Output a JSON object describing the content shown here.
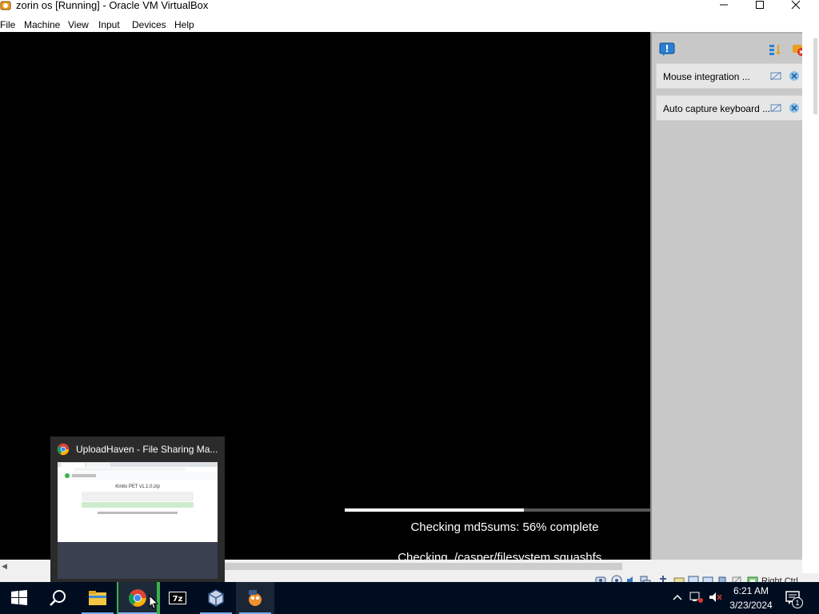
{
  "window": {
    "title": "zorin os [Running] - Oracle VM VirtualBox",
    "controls": [
      "minimize",
      "maximize",
      "close"
    ]
  },
  "menu": {
    "items": [
      "File",
      "Machine",
      "View",
      "Input",
      "Devices",
      "Help"
    ]
  },
  "vm": {
    "progress_percent": 56,
    "progress_text": "Checking md5sums: 56% complete",
    "checking_text": "Checking ./casper/filesystem.squashfs..."
  },
  "notifications": {
    "items": [
      {
        "label": "Mouse integration ..."
      },
      {
        "label": "Auto capture keyboard ..."
      }
    ]
  },
  "statusbar": {
    "host_key": "Right Ctrl"
  },
  "preview": {
    "title": "UploadHaven - File Sharing Ma...",
    "page_heading": "Kinito PET v1.1.0.zip"
  },
  "taskbar": {
    "apps": [
      "start",
      "search",
      "file-explorer",
      "chrome",
      "7zip",
      "virtualbox",
      "virtualbox-vm"
    ],
    "clock_time": "6:21 AM",
    "clock_date": "3/23/2024",
    "notification_count": "1"
  },
  "colors": {
    "taskbar_bg": "#000d20",
    "panel_bg": "#c8c8c8",
    "accent_green": "#3bb14a",
    "progress_fill": "#ffffff"
  }
}
